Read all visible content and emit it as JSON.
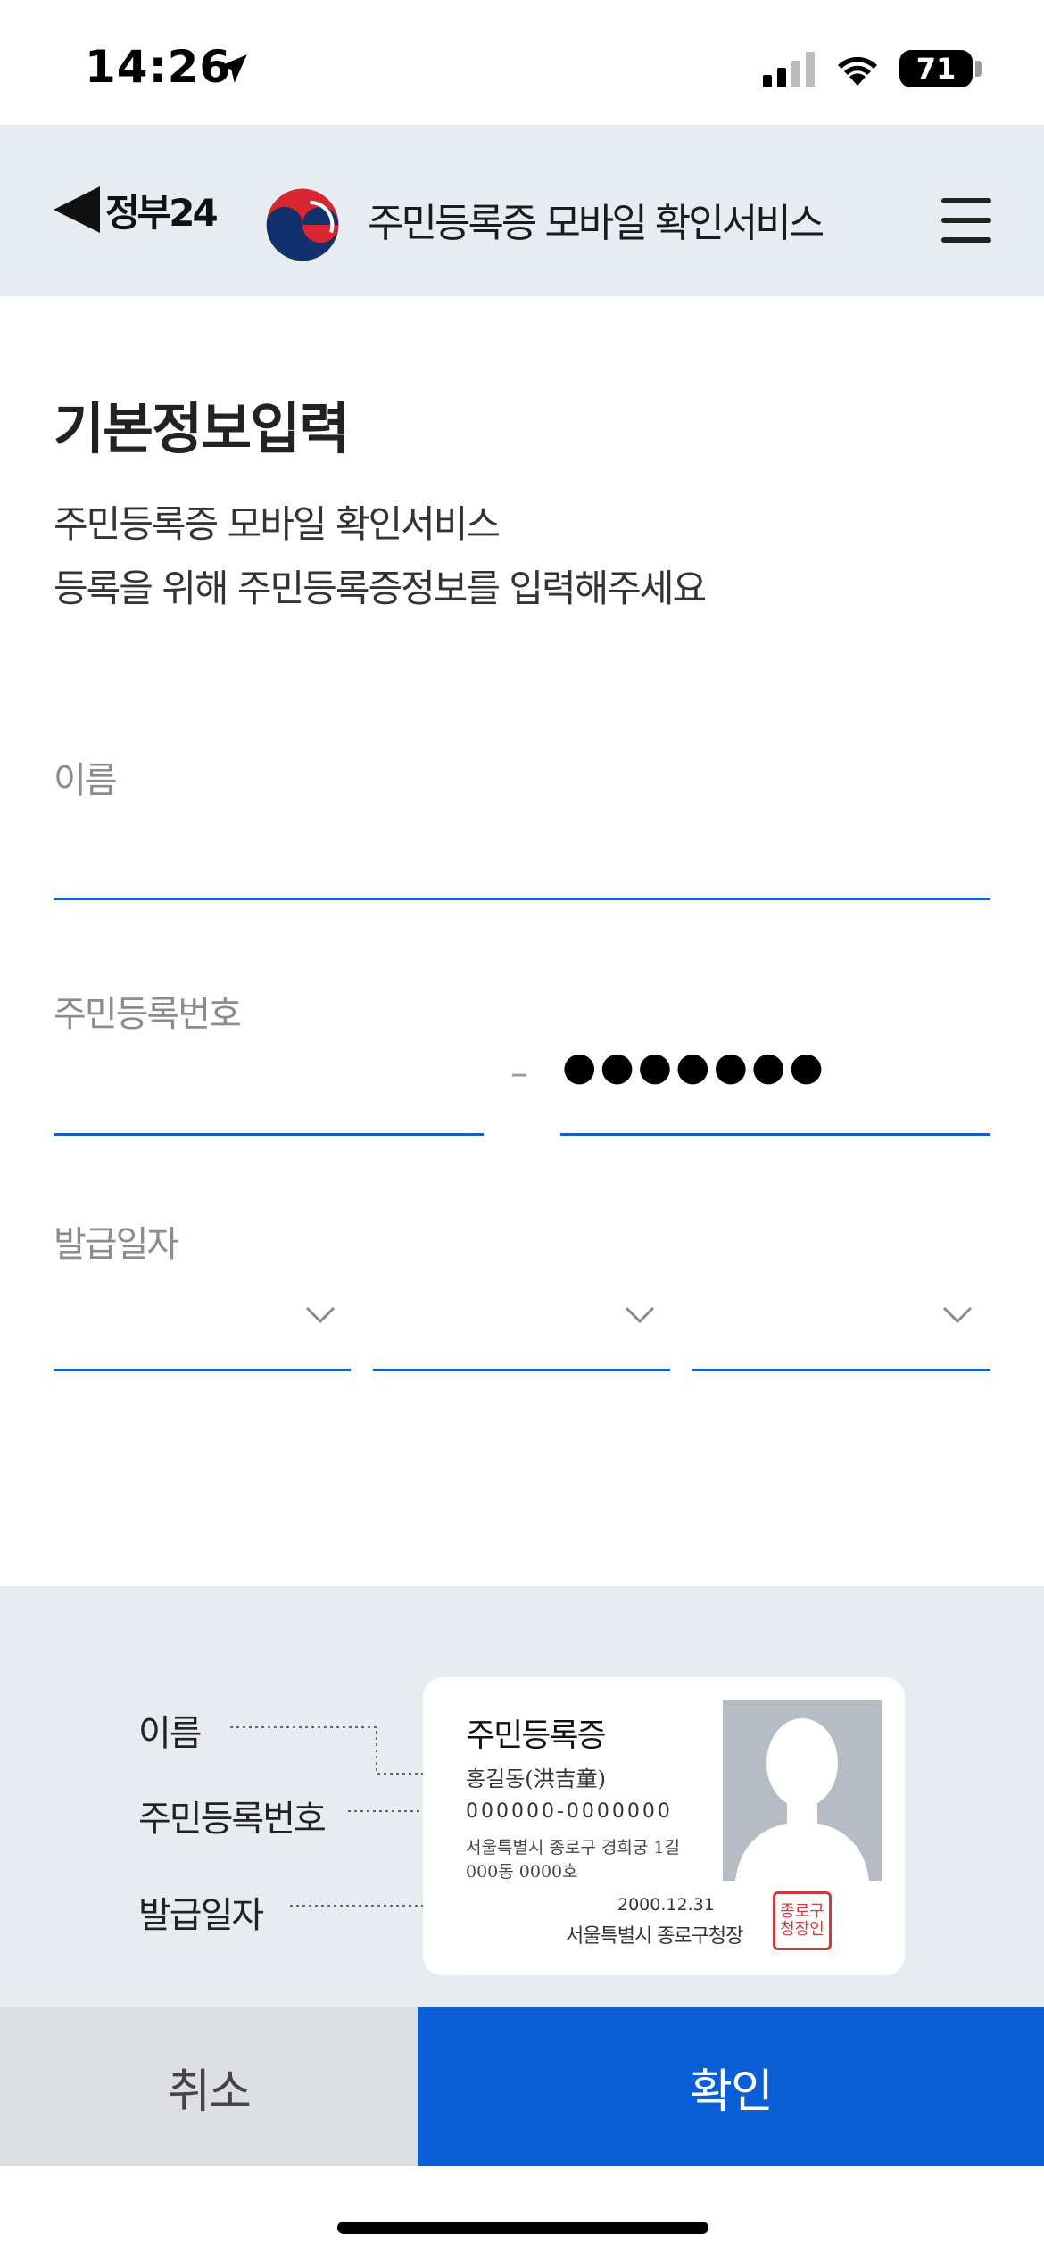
{
  "status_bar": {
    "time": "14:26",
    "battery": "71"
  },
  "header": {
    "back_label": "정부24",
    "title": "주민등록증 모바일 확인서비스"
  },
  "page": {
    "title": "기본정보입력",
    "description_line1": "주민등록증 모바일 확인서비스",
    "description_line2": "등록을 위해 주민등록증정보를 입력해주세요"
  },
  "form": {
    "name_label": "이름",
    "name_value": "",
    "rrn_label": "주민등록번호",
    "rrn_front_value": "",
    "rrn_dash": "–",
    "rrn_back_masked": "●●●●●●●",
    "issue_date_label": "발급일자",
    "issue_year": "",
    "issue_month": "",
    "issue_day": ""
  },
  "illustration": {
    "callout_name": "이름",
    "callout_rrn": "주민등록번호",
    "callout_issue_date": "발급일자",
    "card": {
      "title": "주민등록증",
      "name": "홍길동(洪吉童)",
      "rrn": "000000-0000000",
      "address_line1": "서울특별시 종로구 경희궁 1길",
      "address_line2": "000동 0000호",
      "date": "2000.12.31",
      "issuer": "서울특별시 종로구청장",
      "seal_text": "종로구청장인"
    }
  },
  "buttons": {
    "cancel": "취소",
    "confirm": "확인"
  },
  "colors": {
    "accent": "#0b5fd6",
    "underline": "#1a5ec4",
    "header_bg": "#e6ecf2",
    "info_bg": "#e8ebef"
  }
}
